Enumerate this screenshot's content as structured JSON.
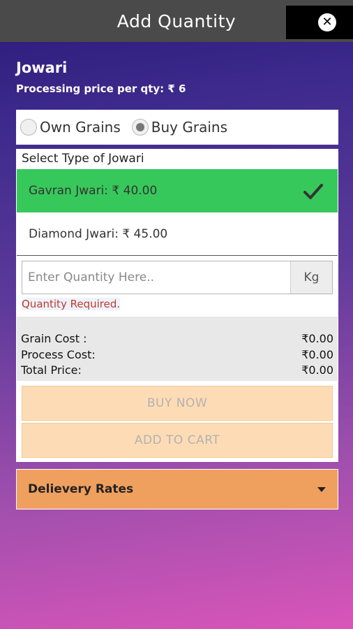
{
  "header": {
    "title": "Add Quantity",
    "close_icon": "close-icon"
  },
  "product": {
    "name": "Jowari",
    "price_label": "Processing price per qty: ₹ 6"
  },
  "grain_options": [
    {
      "label": "Own Grains",
      "selected": false
    },
    {
      "label": "Buy Grains",
      "selected": true
    }
  ],
  "select": {
    "label": "Select Type of Jowari",
    "options": [
      {
        "label": "Gavran Jwari: ₹ 40.00",
        "selected": true
      },
      {
        "label": "Diamond Jwari: ₹ 45.00",
        "selected": false
      }
    ]
  },
  "quantity": {
    "placeholder": "Enter Quantity Here..",
    "value": "",
    "unit": "Kg",
    "error": "Quantity Required."
  },
  "costs": [
    {
      "label": "Grain Cost :",
      "value": "₹0.00"
    },
    {
      "label": "Process Cost:",
      "value": "₹0.00"
    },
    {
      "label": "Total Price:",
      "value": "₹0.00"
    }
  ],
  "buttons": {
    "buy_now": "BUY NOW",
    "add_to_cart": "ADD TO CART"
  },
  "delivery": {
    "label": "Delievery Rates"
  },
  "colors": {
    "selected_option": "#37c85b",
    "action_button": "#fddcb5",
    "delivery_bar": "#f0a05e",
    "error_text": "#c0392b"
  }
}
